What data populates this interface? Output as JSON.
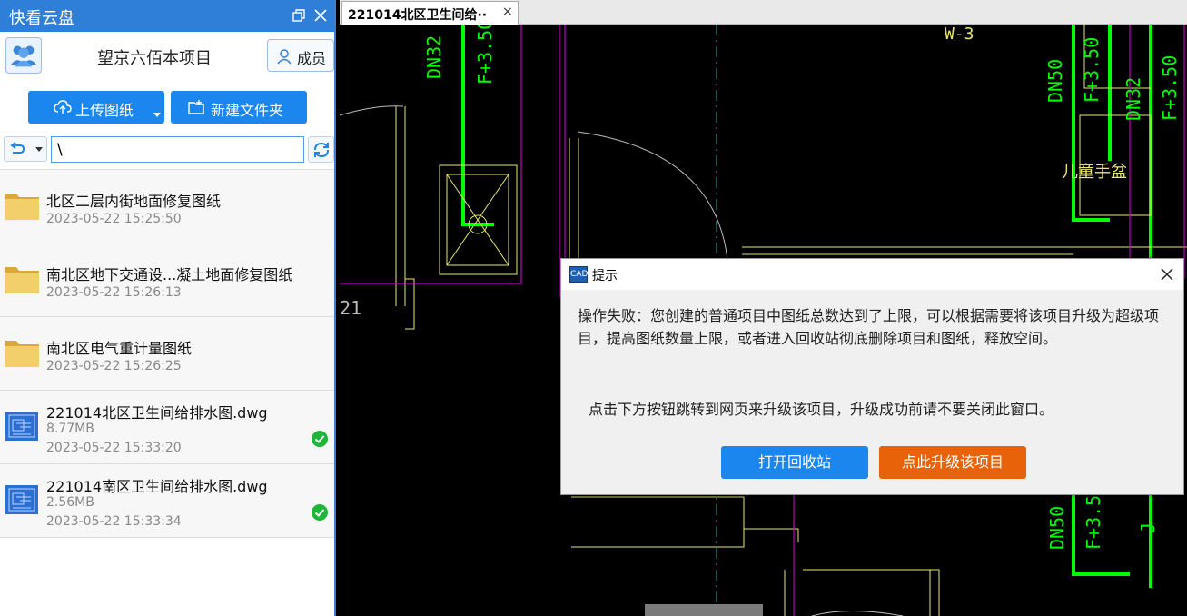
{
  "panel": {
    "title": "快看云盘",
    "project_name": "望京六佰本项目",
    "member_label": "成员",
    "upload_label": "上传图纸",
    "new_folder_label": "新建文件夹",
    "path_value": "\\",
    "items": [
      {
        "kind": "folder",
        "title": "北区二层内街地面修复图纸",
        "size": "",
        "date": "2023-05-22 15:25:50",
        "synced": false
      },
      {
        "kind": "folder",
        "title": "南北区地下交通设...凝土地面修复图纸",
        "size": "",
        "date": "2023-05-22 15:26:13",
        "synced": false
      },
      {
        "kind": "folder",
        "title": "南北区电气重计量图纸",
        "size": "",
        "date": "2023-05-22 15:26:25",
        "synced": false
      },
      {
        "kind": "dwg",
        "title": "221014北区卫生间给排水图.dwg",
        "size": "8.77MB",
        "date": "2023-05-22 15:33:20",
        "synced": true
      },
      {
        "kind": "dwg",
        "title": "221014南区卫生间给排水图.dwg",
        "size": "2.56MB",
        "date": "2023-05-22 15:33:34",
        "synced": true
      }
    ]
  },
  "tab": {
    "label": "221014北区卫生间给··",
    "close": "×"
  },
  "cad_labels": {
    "dn32_left": "DN32",
    "f350_left": "F+3.50",
    "w3": "W-3",
    "dn50_top": "DN50",
    "f350_right": "F+3.50",
    "dn32_right": "DN32",
    "f350_far": "F+3.50",
    "basin": "儿童手盆",
    "num21": "21",
    "dn50_bottom": "DN50",
    "f35_bottom": "F+3.5",
    "j": "J"
  },
  "dialog": {
    "icon_text": "CAD",
    "title": "提示",
    "message": "操作失败：您创建的普通项目中图纸总数达到了上限，可以根据需要将该项目升级为超级项目，提高图纸数量上限，或者进入回收站彻底删除项目和图纸，释放空间。",
    "message2": "点击下方按钮跳转到网页来升级该项目，升级成功前请不要关闭此窗口。",
    "recycle_label": "打开回收站",
    "upgrade_label": "点此升级该项目"
  },
  "colors": {
    "accent": "#1a86ee",
    "titlebar": "#2f7ed8",
    "upgrade": "#e8620a",
    "cad_green": "#00ff00",
    "cad_yellow": "#f0f070",
    "cad_magenta": "#c000c0"
  }
}
